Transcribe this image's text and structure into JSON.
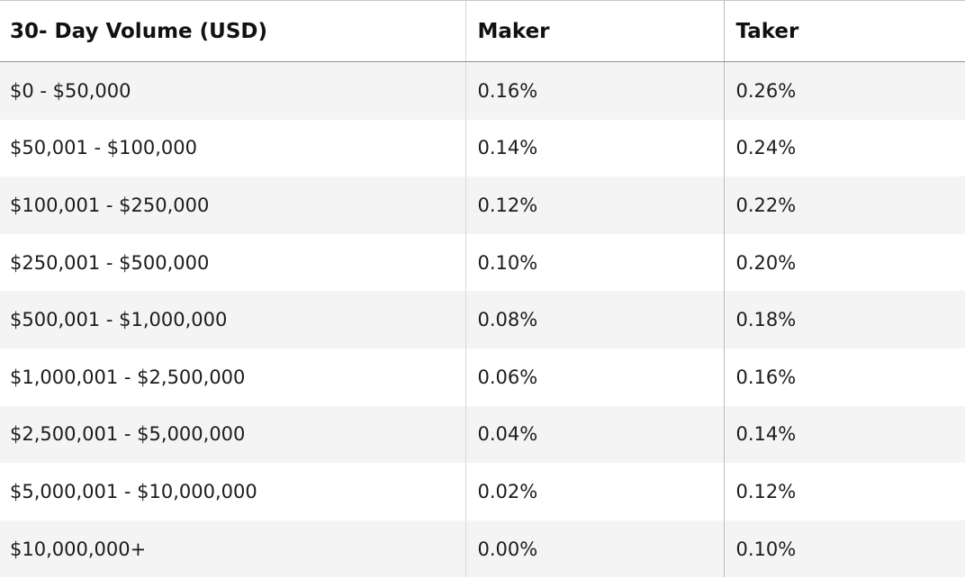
{
  "table": {
    "headers": {
      "volume": "30- Day Volume (USD)",
      "maker": "Maker",
      "taker": "Taker"
    },
    "rows": [
      {
        "volume": "$0 - $50,000",
        "maker": "0.16%",
        "taker": "0.26%"
      },
      {
        "volume": "$50,001 - $100,000",
        "maker": "0.14%",
        "taker": "0.24%"
      },
      {
        "volume": "$100,001 - $250,000",
        "maker": "0.12%",
        "taker": "0.22%"
      },
      {
        "volume": "$250,001 - $500,000",
        "maker": "0.10%",
        "taker": "0.20%"
      },
      {
        "volume": "$500,001 - $1,000,000",
        "maker": "0.08%",
        "taker": "0.18%"
      },
      {
        "volume": "$1,000,001 - $2,500,000",
        "maker": "0.06%",
        "taker": "0.16%"
      },
      {
        "volume": "$2,500,001 - $5,000,000",
        "maker": "0.04%",
        "taker": "0.14%"
      },
      {
        "volume": "$5,000,001 - $10,000,000",
        "maker": "0.02%",
        "taker": "0.12%"
      },
      {
        "volume": "$10,000,000+",
        "maker": "0.00%",
        "taker": "0.10%"
      }
    ]
  }
}
